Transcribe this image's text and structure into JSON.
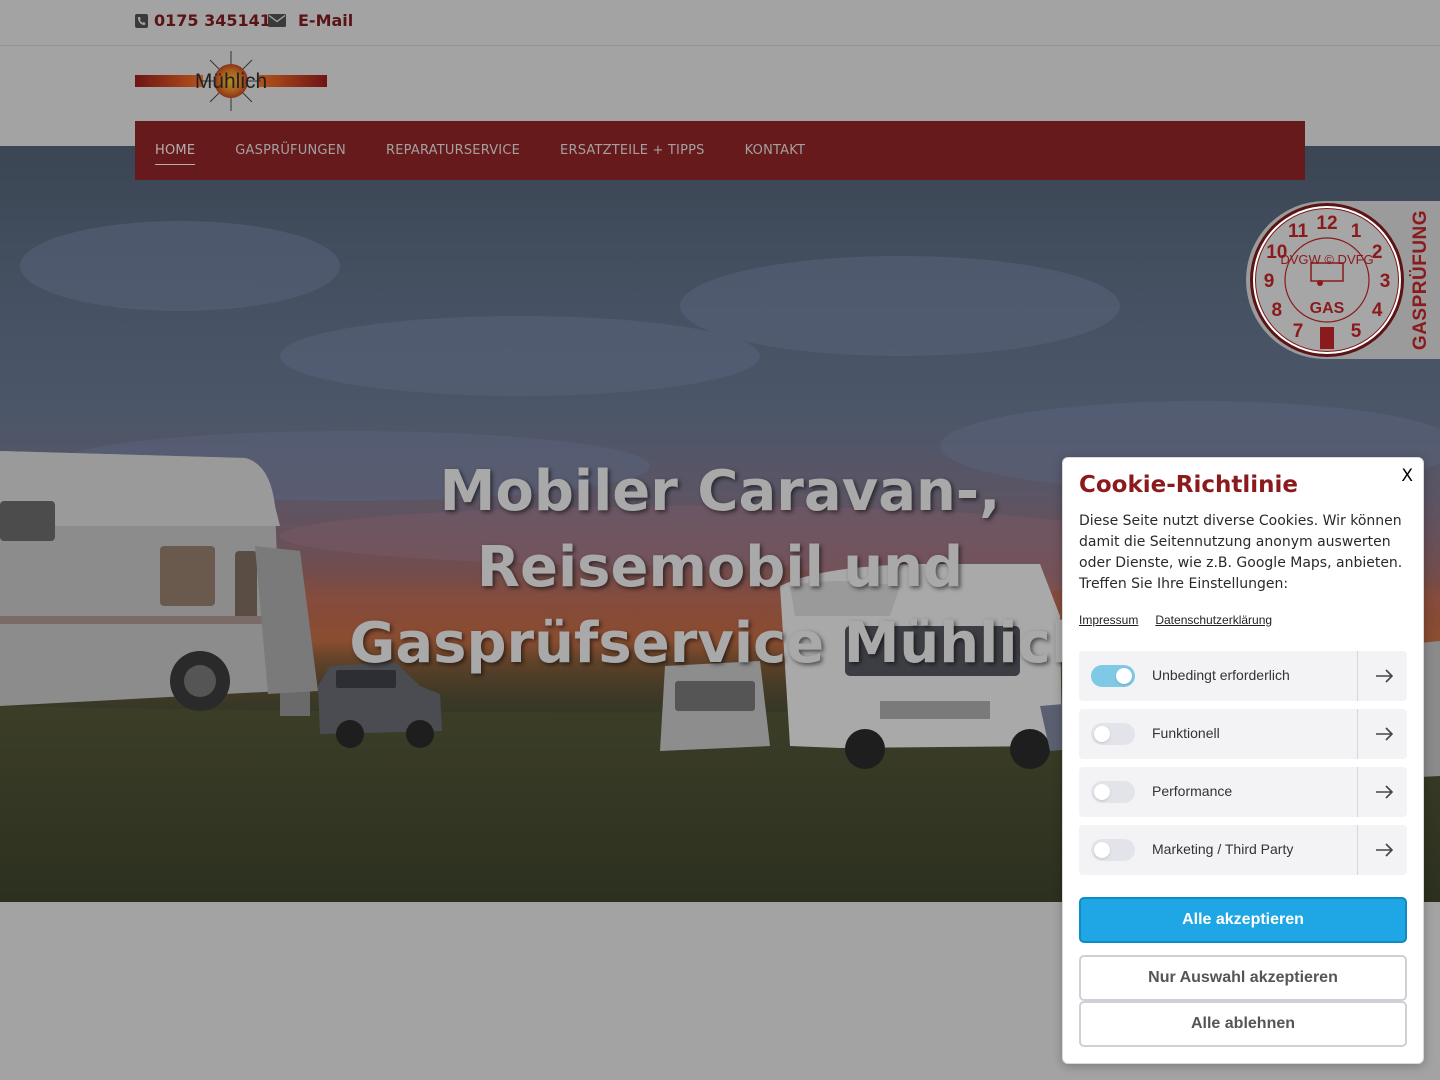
{
  "topbar": {
    "phone": "0175 3451411",
    "email_label": "E-Mail",
    "phone_icon": "phone-icon",
    "email_icon": "envelope-icon"
  },
  "logo": {
    "text": "Mühlich"
  },
  "nav": {
    "items": [
      {
        "label": "Home",
        "active": true
      },
      {
        "label": "Gasprüfungen"
      },
      {
        "label": "Reparaturservice"
      },
      {
        "label": "Ersatzteile + Tipps"
      },
      {
        "label": "Kontakt"
      }
    ]
  },
  "hero": {
    "title_lines": [
      "Mobiler Caravan-,",
      "Reisemobil und",
      "Gasprüfservice Mühlich"
    ]
  },
  "badge": {
    "label": "GASPRÜFUNG",
    "seal_numbers": [
      "12",
      "1",
      "2",
      "3",
      "4",
      "5",
      "6",
      "7",
      "8",
      "9",
      "10",
      "11"
    ],
    "seal_top": "DVGW © DVFG",
    "seal_center": "GAS"
  },
  "cookie": {
    "close": "X",
    "title": "Cookie-Richtlinie",
    "text": "Diese Seite nutzt diverse Cookies. Wir können damit die Seitennutzung anonym auswerten oder Dienste, wie z.B. Google Maps, anbieten. Treffen Sie Ihre Einstellungen:",
    "links": {
      "impressum": "Impressum",
      "privacy": "Datenschutzerklärung"
    },
    "categories": [
      {
        "label": "Unbedingt erforderlich",
        "enabled": true
      },
      {
        "label": "Funktionell",
        "enabled": false
      },
      {
        "label": "Performance",
        "enabled": false
      },
      {
        "label": "Marketing / Third Party",
        "enabled": false
      }
    ],
    "buttons": {
      "accept_all": "Alle akzeptieren",
      "accept_selection": "Nur Auswahl akzeptieren",
      "reject_all": "Alle ablehnen"
    }
  },
  "colors": {
    "brand_red": "#661a1c",
    "accent_blue": "#1ea7e4"
  }
}
